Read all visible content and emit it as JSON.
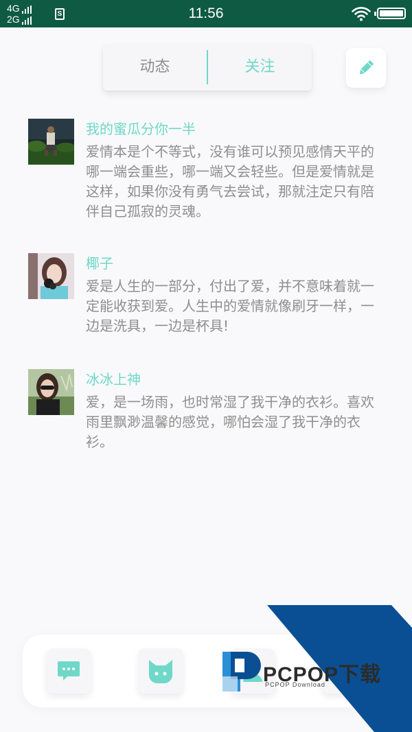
{
  "status_bar": {
    "network_top": "4G",
    "network_bottom": "2G",
    "sim_label": "S",
    "time": "11:56",
    "icons": [
      "signal-icon",
      "sim-icon",
      "wifi-icon",
      "battery-icon"
    ]
  },
  "tabs": [
    {
      "label": "动态",
      "selected": false
    },
    {
      "label": "关注",
      "selected": true
    }
  ],
  "colors": {
    "accent": "#6fd8c8",
    "status_bar": "#0f5a43",
    "text_muted": "#8e8e8e",
    "background": "#f9f9fb"
  },
  "posts": [
    {
      "name": "我的蜜瓜分你一半",
      "text": "爱情本是个不等式，没有谁可以预见感情天平的哪一端会重些，哪一端又会轻些。但是爱情就是这样，如果你没有勇气去尝试，那就注定只有陪伴自己孤寂的灵魂。"
    },
    {
      "name": "椰子",
      "text": "爱是人生的一部分，付出了爱，并不意味着就一定能收获到爱。人生中的爱情就像刷牙一样，一边是洗具，一边是杯具!"
    },
    {
      "name": "冰冰上神",
      "text": "爱，是一场雨，也时常湿了我干净的衣衫。喜欢雨里飘渺温馨的感觉，哪怕会湿了我干净的衣衫。"
    }
  ],
  "bottom_nav": [
    {
      "icon": "message-icon"
    },
    {
      "icon": "cat-icon"
    },
    {
      "icon": "profile-icon"
    },
    {
      "icon": "more-icon"
    }
  ],
  "watermark": {
    "brand": "PCPOP下载",
    "sub": "PCPOP Download"
  }
}
